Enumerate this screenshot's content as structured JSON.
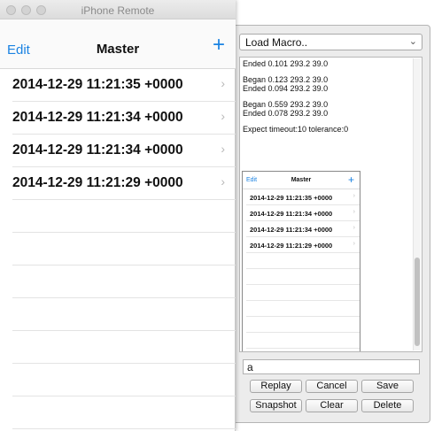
{
  "left_window": {
    "title": "iPhone Remote",
    "nav": {
      "edit_label": "Edit",
      "title": "Master",
      "add_icon": "+"
    },
    "rows": [
      "2014-12-29 11:21:35 +0000",
      "2014-12-29 11:21:34 +0000",
      "2014-12-29 11:21:34 +0000",
      "2014-12-29 11:21:29 +0000"
    ]
  },
  "right_window": {
    "macro_select": "Load Macro..",
    "log": [
      "Ended 0.101 293.2 39.0",
      "Began 0.123 293.2 39.0",
      "Ended 0.094 293.2 39.0",
      "Began 0.559 293.2 39.0",
      "Ended 0.078 293.2 39.0",
      "Expect timeout:10 tolerance:0"
    ],
    "snapshot": {
      "edit_label": "Edit",
      "title": "Master",
      "add_icon": "+",
      "rows": [
        "2014-12-29 11:21:35 +0000",
        "2014-12-29 11:21:34 +0000",
        "2014-12-29 11:21:34 +0000",
        "2014-12-29 11:21:29 +0000"
      ]
    },
    "input_value": "a",
    "buttons": {
      "replay": "Replay",
      "cancel": "Cancel",
      "save": "Save",
      "snapshot": "Snapshot",
      "clear": "Clear",
      "delete": "Delete"
    }
  },
  "colors": {
    "accent": "#1a82e2"
  }
}
